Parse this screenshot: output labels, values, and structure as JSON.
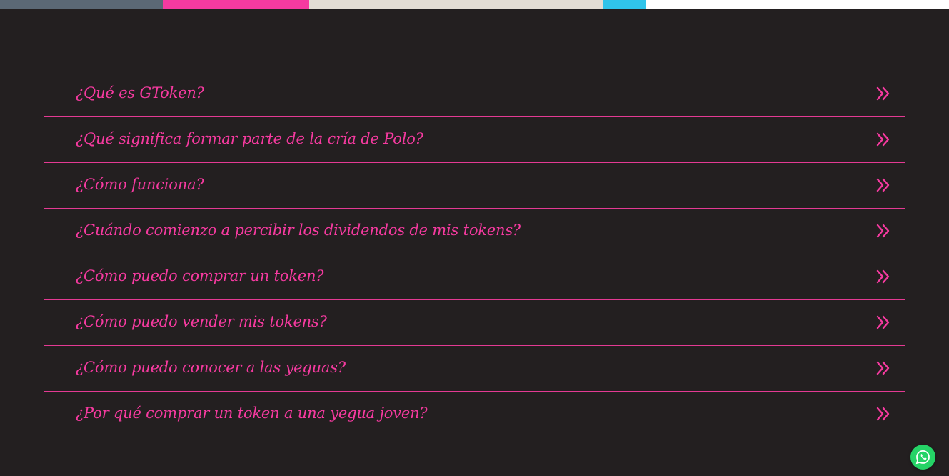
{
  "top_strip": {
    "colors": [
      "#5b6875",
      "#f63aa0",
      "#e3ddd4",
      "#30c4ea"
    ]
  },
  "faq": {
    "items": [
      {
        "question": "¿Qué es GToken?"
      },
      {
        "question": "¿Qué significa formar parte de la cría de Polo?"
      },
      {
        "question": "¿Cómo funciona?"
      },
      {
        "question": "¿Cuándo comienzo a percibir los dividendos de mis tokens?"
      },
      {
        "question": "¿Cómo puedo comprar un token?"
      },
      {
        "question": "¿Cómo puedo vender mis tokens?"
      },
      {
        "question": "¿Cómo puedo conocer a las yeguas?"
      },
      {
        "question": "¿Por qué comprar un token a una yegua joven?"
      }
    ],
    "icon": "double-chevron-right-icon",
    "accent_color": "#f63aa0"
  },
  "floating": {
    "icon": "whatsapp-icon",
    "color": "#25d366"
  },
  "page": {
    "background": "#231f20"
  }
}
